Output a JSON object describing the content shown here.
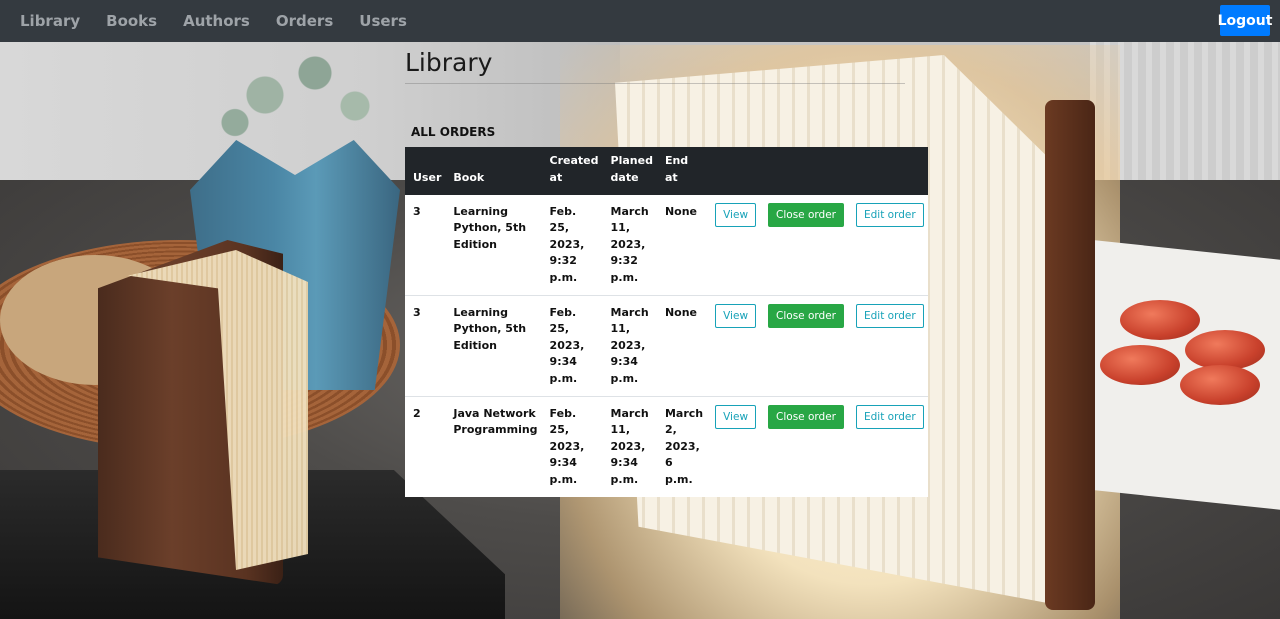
{
  "navbar": {
    "links": [
      "Library",
      "Books",
      "Authors",
      "Orders",
      "Users"
    ],
    "logout_label": "Logout"
  },
  "page": {
    "title": "Library",
    "section_label": "ALL ORDERS"
  },
  "table": {
    "headers": {
      "user": "User",
      "book": "Book",
      "created_at": "Created at",
      "planed_date": "Planed date",
      "end_at": "End at"
    },
    "rows": [
      {
        "user": "3",
        "book": "Learning Python, 5th Edition",
        "created_at": "Feb. 25, 2023, 9:32 p.m.",
        "planed_date": "March 11, 2023, 9:32 p.m.",
        "end_at": "None"
      },
      {
        "user": "3",
        "book": "Learning Python, 5th Edition",
        "created_at": "Feb. 25, 2023, 9:34 p.m.",
        "planed_date": "March 11, 2023, 9:34 p.m.",
        "end_at": "None"
      },
      {
        "user": "2",
        "book": "Java Network Programming",
        "created_at": "Feb. 25, 2023, 9:34 p.m.",
        "planed_date": "March 11, 2023, 9:34 p.m.",
        "end_at": "March 2, 2023, 6 p.m."
      }
    ],
    "actions": {
      "view_label": "View",
      "close_label": "Close order",
      "edit_label": "Edit order"
    }
  },
  "colors": {
    "navbar_bg": "#343a40",
    "primary": "#007bff",
    "success": "#28a745",
    "info": "#17a2b8",
    "table_header_bg": "#212529"
  }
}
